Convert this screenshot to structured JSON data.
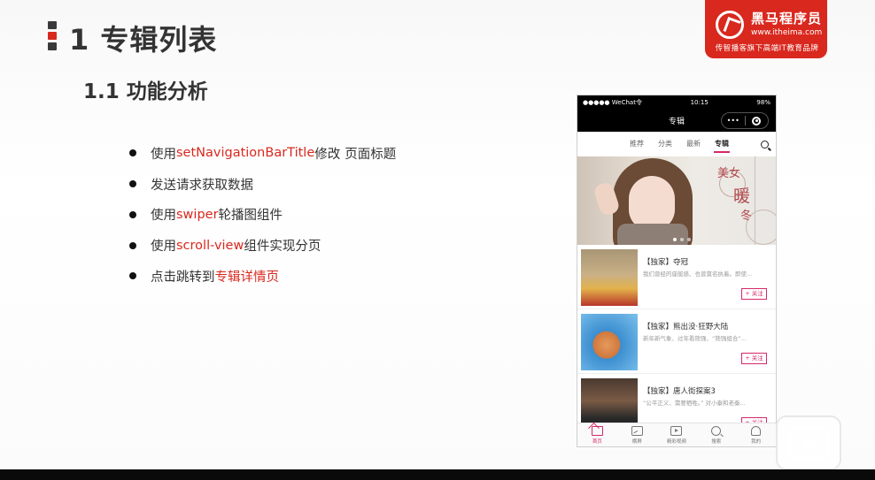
{
  "slide": {
    "title": "1 专辑列表",
    "subtitle": "1.1 功能分析"
  },
  "logo": {
    "name": "黑马程序员",
    "url": "www.itheima.com",
    "slogan": "传智播客旗下高端IT教育品牌",
    "color": "#d9281e"
  },
  "bullets": [
    {
      "pre": "使用 ",
      "hl": "setNavigationBarTitle",
      "post": " 修改",
      "post2": "页面标题"
    },
    {
      "pre": "发送请求获取数据",
      "hl": "",
      "post": "",
      "post2": ""
    },
    {
      "pre": "使用 ",
      "hl": "swiper",
      "post": " 轮播图组件",
      "post2": ""
    },
    {
      "pre": "使用 ",
      "hl": "scroll-view",
      "post": " 组件实现分页",
      "post2": ""
    },
    {
      "pre": "点击跳转到 ",
      "hl": "专辑详情页",
      "post": "",
      "post2": ""
    }
  ],
  "phone": {
    "status": {
      "carrier": "●●●●● WeChat令",
      "time": "10:15",
      "battery": "98%"
    },
    "nav_title": "专辑",
    "capsule_more": "•••",
    "tabs": [
      "推荐",
      "分类",
      "最新",
      "专辑"
    ],
    "active_tab": 3,
    "banner": {
      "t1": "美女",
      "t2": "暖",
      "t3": "冬"
    },
    "albums": [
      {
        "title": "【独家】夺冠",
        "desc": "我们曾经的座艇惑、也曾莫名执着。即使...",
        "follow": "+ 关注",
        "thumb": "thumb-0"
      },
      {
        "title": "【独家】熊出没·狂野大陆",
        "desc": "新年新气象、过年看熊强、“熊强组合”...",
        "follow": "+ 关注",
        "thumb": "thumb-1"
      },
      {
        "title": "【独家】唐人街探案3",
        "desc": "“公平正义、需要牺牲。” 对小秦和老秦...",
        "follow": "+ 关注",
        "thumb": "thumb-2"
      }
    ],
    "tabbar": [
      {
        "label": "首页",
        "icon": "home-icon"
      },
      {
        "label": "横屏",
        "icon": "image-icon"
      },
      {
        "label": "精彩视频",
        "icon": "video-icon"
      },
      {
        "label": "搜索",
        "icon": "search-icon"
      },
      {
        "label": "我的",
        "icon": "user-icon"
      }
    ],
    "accent": "#d5286a"
  }
}
